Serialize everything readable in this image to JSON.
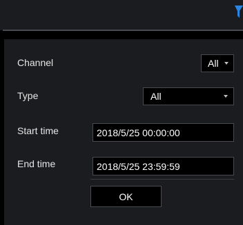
{
  "colors": {
    "background": "#000000",
    "panel": "#1b1c1f",
    "border": "#4a4b50",
    "text": "#e6e6e6",
    "accent": "#2b86e3"
  },
  "header": {
    "filter_icon": "filter-icon"
  },
  "form": {
    "channel": {
      "label": "Channel",
      "value": "All"
    },
    "type": {
      "label": "Type",
      "value": "All"
    },
    "start_time": {
      "label": "Start time",
      "value": "2018/5/25 00:00:00"
    },
    "end_time": {
      "label": "End time",
      "value": "2018/5/25 23:59:59"
    },
    "ok_label": "OK"
  }
}
